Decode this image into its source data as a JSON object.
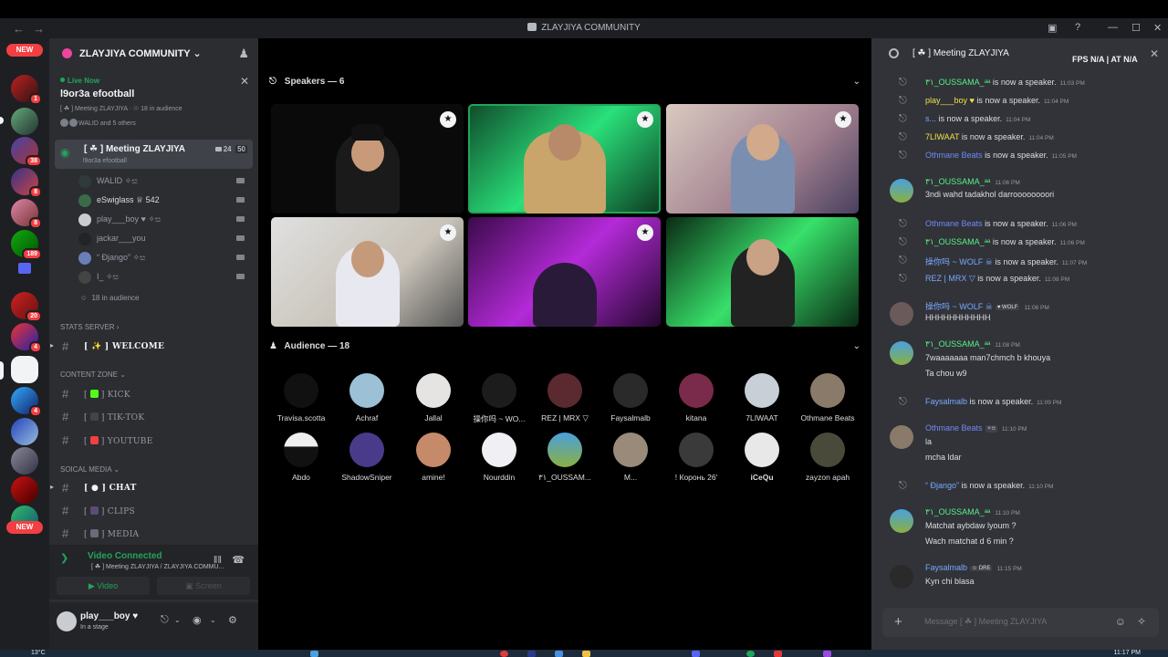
{
  "window": {
    "title": "ZLAYJIYA COMMUNITY",
    "nav_back": "←",
    "nav_forward": "→",
    "controls": [
      "▣",
      "?",
      "—",
      "☐",
      "✕"
    ]
  },
  "guilds": {
    "new_label": "NEW",
    "badges": [
      "1",
      "38",
      "8",
      "8",
      "189",
      "20",
      "4",
      "4"
    ]
  },
  "server": {
    "name": "ZLAYJIYA COMMUNITY",
    "live_label": "Live Now",
    "topic": "l9or3a efootball",
    "stage_line": "[ ☘ ] Meeting ZLAYJIYA · ☉ 18 in audience",
    "members_line": "WALID and 5 others"
  },
  "stage_channel": {
    "name": "[ ☘ ] Meeting ZLAYJIYA",
    "topic": "l9or3a efootball",
    "video_count": "24",
    "user_limit": "50",
    "users": [
      {
        "name": "WALID ✧ස"
      },
      {
        "name": "eSwiglass ♕ 542"
      },
      {
        "name": "play___boy ♥ ✧ස"
      },
      {
        "name": "jackar___you"
      },
      {
        "name": "“ Đjango” ✧ස"
      },
      {
        "name": "I_ ✧ස"
      }
    ],
    "audience": "18 in audience"
  },
  "categories": {
    "stats": "STATS SERVER",
    "content": "CONTENT ZONE",
    "social": "SOICAL MEDIA"
  },
  "channels": {
    "welcome": "WELCOME",
    "kick": "KICK",
    "tiktok": "TIK-TOK",
    "youtube": "YOUTUBE",
    "chat": "CHAT",
    "clips": "CLIPS",
    "media": "MEDIA"
  },
  "voice_panel": {
    "status": "Video Connected",
    "location": "[ ☘ ] Meeting ZLAYJIYA / ZLAYJIYA COMMU...",
    "video_label": "Video",
    "screen_label": "Screen"
  },
  "user": {
    "name": "play___boy ♥",
    "status": "In a stage"
  },
  "stage": {
    "speakers_header": "Speakers — 6",
    "audience_header": "Audience — 18",
    "audience": [
      "Travisa.scotta",
      "Achraf",
      "Jallal",
      "操你吗 ~ WO...",
      "REZ | MRX ▽",
      "Faysalmalb",
      "kitana",
      "7LIWAAT",
      "Othmane Beats",
      "Abdo",
      "ShadowSniper",
      "amine!",
      "Nourddin",
      "٣١_OUSSAM...",
      "M...",
      "! Коронь 26'",
      "iCeQu",
      "zayzon apah"
    ]
  },
  "chat": {
    "title": "[ ☘ ] Meeting ZLAYJIYA",
    "fps_label": "FPS N/A   |   AT N/A",
    "placeholder": "Message  [ ☘ ] Meeting ZLAYJIYA",
    "speaker_suffix": "is now a speaker.",
    "sys1": {
      "who": "٣١_OUSSAMA_ᵃᵃ",
      "time": "11:03 PM"
    },
    "sys2": {
      "who": "play___boy ♥",
      "time": "11:04 PM"
    },
    "sys3": {
      "who": "s...",
      "time": "11:04 PM"
    },
    "sys4": {
      "who": "7LIWAAT",
      "time": "11:04 PM"
    },
    "sys5": {
      "who": "Othmane Beats",
      "time": "11:05 PM"
    },
    "m1": {
      "name": "٣١_OUSSAMA_ᵃᵃ",
      "time": "11:06 PM",
      "lines": [
        "3ndi wahd tadakhol darroooooooori"
      ]
    },
    "sys6": {
      "who": "Othmane Beats",
      "time": "11:06 PM"
    },
    "sys7": {
      "who": "٣١_OUSSAMA_ᵃᵃ",
      "time": "11:06 PM"
    },
    "sys8": {
      "who": "操你吗 ~ WOLF ☠",
      "time": "11:07 PM"
    },
    "sys9": {
      "who": "REZ | MRX ▽",
      "time": "11:08 PM"
    },
    "m2": {
      "name": "操你吗 ~ WOLF ☠",
      "tag": "♥ WOLF",
      "time": "11:08 PM",
      "lines": [
        "HHHHHHHHHHH"
      ]
    },
    "m3": {
      "name": "٣١_OUSSAMA_ᵃᵃ",
      "time": "11:08 PM",
      "lines": [
        "7waaaaaaa man7chmch b khouya",
        "Ta chou w9"
      ]
    },
    "sys10": {
      "who": "Faysalmalb",
      "time": "11:09 PM"
    },
    "m4": {
      "name": "Othmane Beats",
      "tag": "✧ස",
      "time": "11:10 PM",
      "lines": [
        "la",
        "mcha ldar"
      ]
    },
    "sys11": {
      "who": "“ Đjango”",
      "time": "11:10 PM"
    },
    "m5": {
      "name": "٣١_OUSSAMA_ᵃᵃ",
      "time": "11:10 PM",
      "lines": [
        "Matchat aybdaw lyoum ?",
        "Wach matchat d 6 min ?"
      ]
    },
    "m6": {
      "name": "Faysalmalb",
      "tag": "☺ DRE",
      "time": "11:15 PM",
      "lines": [
        "Kyn chi blasa"
      ]
    }
  },
  "taskbar": {
    "weather": "13°C",
    "clock": "11:17 PM"
  }
}
